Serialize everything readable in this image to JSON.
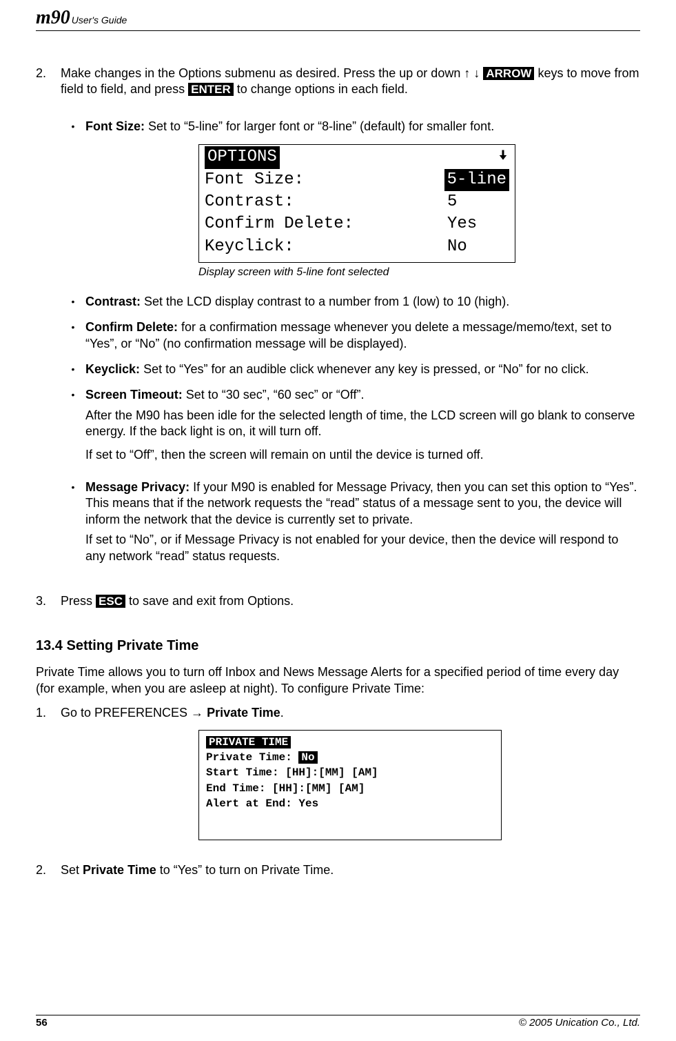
{
  "header": {
    "brand_model": "m90",
    "brand_suffix": "User's Guide"
  },
  "steps_top": {
    "num": "2.",
    "text_before_arrows": "Make changes in the Options submenu as desired. Press the up or down ",
    "arrow_up": "↑",
    "arrow_dn": "↓",
    "key_arrow": "ARROW",
    "text_mid": " keys to move from field to field, and press ",
    "key_enter": "ENTER",
    "text_after": " to change options in each field."
  },
  "bullets1": [
    {
      "lead": "Font Size:",
      "text": " Set to “5-line” for larger font or “8-line” (default) for smaller font."
    }
  ],
  "screen_big": {
    "title": " OPTIONS ",
    "rows": [
      {
        "l": "Font Size:",
        "r": "5-line",
        "r_inv": true
      },
      {
        "l": "Contrast:",
        "r": "5",
        "r_inv": false
      },
      {
        "l": "Confirm Delete:",
        "r": "Yes",
        "r_inv": false
      },
      {
        "l": "Keyclick:",
        "r": "No",
        "r_inv": false
      }
    ],
    "caption": "Display screen with 5-line font selected"
  },
  "bullets2": [
    {
      "lead": "Contrast:",
      "text": " Set the LCD display contrast to a number from 1 (low) to 10 (high)."
    },
    {
      "lead": "Confirm Delete:",
      "text": " for a confirmation message whenever you delete a message/memo/text, set to “Yes”, or “No” (no confirmation message will be displayed)."
    },
    {
      "lead": "Keyclick:",
      "text": " Set to “Yes” for an audible click whenever any key is pressed, or “No” for no click."
    },
    {
      "lead": "Screen Timeout:",
      "text": " Set to “30 sec”, “60 sec” or “Off”.",
      "paras": [
        "After the M90 has been idle for the selected length of time, the LCD screen will go blank to conserve energy. If the back light is on, it will turn off.",
        "If set to “Off”, then the screen will remain on until the device is turned off."
      ]
    },
    {
      "lead": "Message Privacy:",
      "text": " If your M90 is enabled for Message Privacy, then you can set this option to “Yes”. This means that if the network requests the “read” status of a message sent to you, the device will inform the network that the device is currently set to private.",
      "paras": [
        "If set to “No”, or if Message Privacy is not enabled for your device, then the device will respond to any network “read” status requests."
      ]
    }
  ],
  "step3": {
    "num": "3.",
    "pre": "Press ",
    "key": "ESC",
    "post": " to save and exit from Options."
  },
  "sec": {
    "heading": "13.4  Setting Private Time",
    "intro": "Private Time allows you to turn off Inbox and News Message Alerts for a specified period of time every day (for example, when you are asleep at night). To configure Private Time:"
  },
  "sec_steps": {
    "s1": {
      "num": "1.",
      "pre": "Go to PREFERENCES → ",
      "bold": "Private Time",
      "post": "."
    },
    "s2": {
      "num": "2.",
      "pre": "Set ",
      "bold": "Private Time",
      "post": " to “Yes” to turn on Private Time."
    }
  },
  "screen_small": {
    "title": " PRIVATE TIME ",
    "l1a": "Private Time: ",
    "l1b": "No",
    "l2": "Start Time:   [HH]:[MM] [AM]",
    "l3": "End Time:     [HH]:[MM] [AM]",
    "l4": "Alert at End: Yes"
  },
  "footer": {
    "page": "56",
    "copy": "© 2005 Unication Co., Ltd."
  }
}
